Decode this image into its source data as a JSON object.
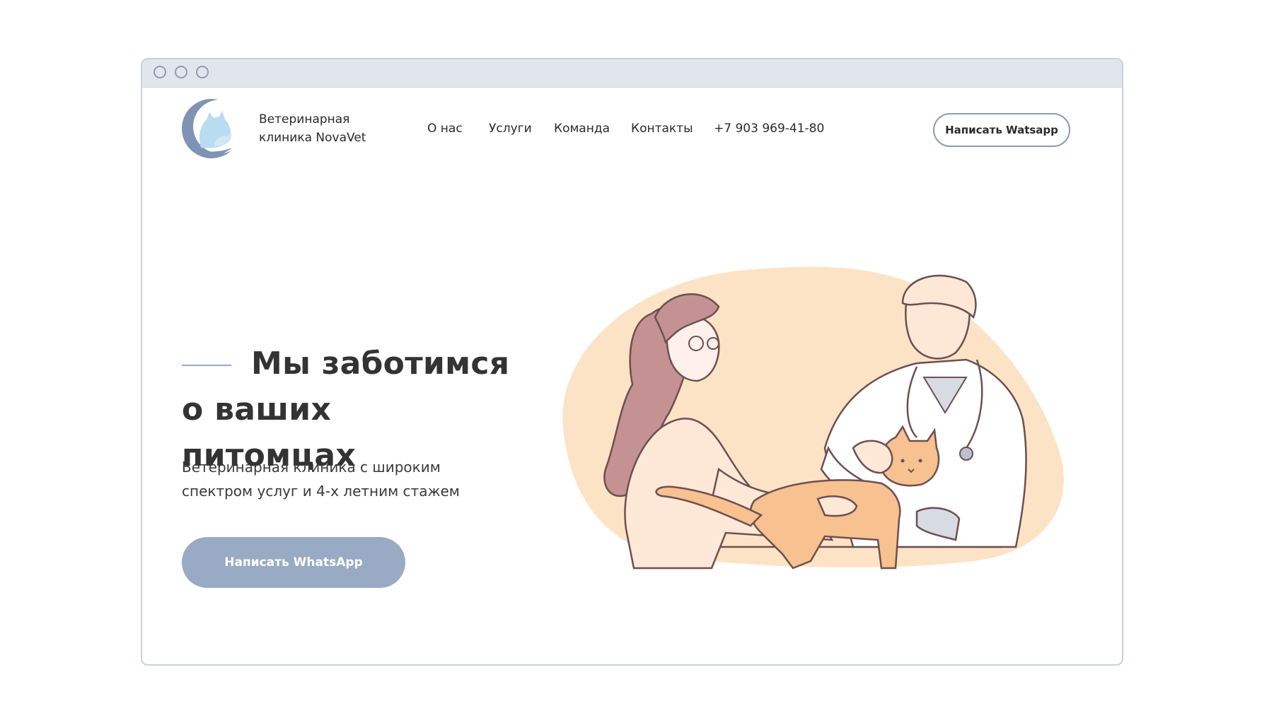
{
  "brand": {
    "line1": "Ветеринарная",
    "line2": "клиника NovaVet",
    "logo_icon": "cat-dog-hand-logo"
  },
  "nav": {
    "items": [
      {
        "label": "О нас"
      },
      {
        "label": "Услуги"
      },
      {
        "label": "Команда"
      },
      {
        "label": "Контакты"
      }
    ],
    "phone": "+7 903 969-41-80",
    "cta_label": "Написать Watsapp"
  },
  "hero": {
    "title": "Мы заботимся о ваших питомцах",
    "subtitle": "Ветеринарная клиника с широким спектром услуг и 4-х летним стажем",
    "cta_label": "Написать WhatsApp",
    "illustration": "vet-doctor-with-woman-and-cat"
  },
  "colors": {
    "accent": "#99aac4",
    "blob": "#fde3c6",
    "text": "#333333"
  }
}
